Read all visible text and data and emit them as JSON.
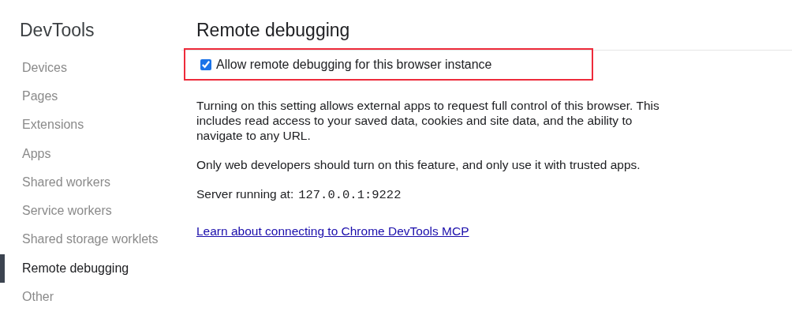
{
  "sidebar": {
    "title": "DevTools",
    "items": [
      {
        "label": "Devices",
        "selected": false
      },
      {
        "label": "Pages",
        "selected": false
      },
      {
        "label": "Extensions",
        "selected": false
      },
      {
        "label": "Apps",
        "selected": false
      },
      {
        "label": "Shared workers",
        "selected": false
      },
      {
        "label": "Service workers",
        "selected": false
      },
      {
        "label": "Shared storage worklets",
        "selected": false
      },
      {
        "label": "Remote debugging",
        "selected": true
      },
      {
        "label": "Other",
        "selected": false
      }
    ]
  },
  "main": {
    "title": "Remote debugging",
    "setting": {
      "label": "Allow remote debugging for this browser instance",
      "checked": true,
      "highlighted": true
    },
    "paragraphs": [
      "Turning on this setting allows external apps to request full control of this browser. This includes read access to your saved data, cookies and site data, and the ability to navigate to any URL.",
      "Only web developers should turn on this feature, and only use it with trusted apps."
    ],
    "server": {
      "label": "Server running at:",
      "address": "127.0.0.1:9222"
    },
    "link": "Learn about connecting to Chrome DevTools MCP"
  }
}
